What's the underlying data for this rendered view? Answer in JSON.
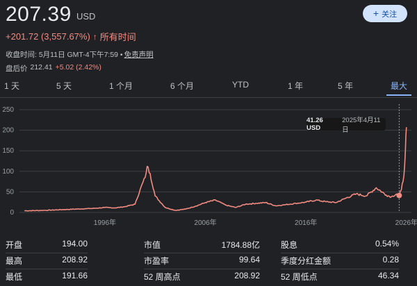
{
  "header": {
    "price": "207.39",
    "currency": "USD",
    "change": "+201.72 (3,557.67%)",
    "change_arrow": "↑",
    "change_period": "所有时间",
    "close_time": "收盘时间: 5月11日 GMT-4下午7:59 •",
    "disclaimer": "免责声明",
    "after_hours_label": "盘后价",
    "after_hours_price": "212.41",
    "after_hours_change": "+5.02 (2.42%)"
  },
  "follow_button": {
    "label": "关注",
    "icon": "plus-icon"
  },
  "tabs": [
    "1 天",
    "5 天",
    "1 个月",
    "6 个月",
    "YTD",
    "1 年",
    "5 年",
    "最大"
  ],
  "active_tab": "最大",
  "tooltip": {
    "value": "41.26 USD",
    "date": "2025年4月11日"
  },
  "colors": {
    "line": "#f28b82",
    "accent": "#8ab4f8",
    "background": "#202124",
    "follow_bg": "#d2e3fc"
  },
  "chart_data": {
    "type": "line",
    "yticks": [
      "0",
      "50",
      "100",
      "150",
      "200",
      "250"
    ],
    "ylim": [
      0,
      250
    ],
    "xticks": [
      "1996年",
      "2006年",
      "2016年",
      "2026年"
    ],
    "xlim": [
      1987.5,
      2026.5
    ],
    "grid": true,
    "x": [
      1988,
      1990,
      1992,
      1994,
      1995,
      1996,
      1997,
      1998,
      1999,
      1999.5,
      2000,
      2000.2,
      2000.5,
      2001,
      2002,
      2003,
      2004,
      2005,
      2006,
      2007,
      2008,
      2009,
      2010,
      2011,
      2012,
      2013,
      2014,
      2015,
      2016,
      2017,
      2018,
      2019,
      2020,
      2021,
      2022,
      2023,
      2024,
      2024.5,
      2025,
      2025.28,
      2025.5,
      2025.75,
      2025.9,
      2026
    ],
    "y": [
      4,
      5,
      7,
      9,
      10,
      12,
      11,
      14,
      20,
      55,
      85,
      112,
      95,
      40,
      12,
      5,
      8,
      15,
      24,
      30,
      18,
      12,
      20,
      22,
      24,
      16,
      19,
      22,
      25,
      30,
      26,
      24,
      35,
      45,
      40,
      60,
      42,
      38,
      45,
      41.26,
      55,
      90,
      150,
      207.39
    ]
  },
  "stats": [
    [
      {
        "label": "开盘",
        "value": "194.00"
      },
      {
        "label": "市值",
        "value": "1784.88亿"
      },
      {
        "label": "股息",
        "value": "0.54%"
      }
    ],
    [
      {
        "label": "最高",
        "value": "208.92"
      },
      {
        "label": "市盈率",
        "value": "99.64"
      },
      {
        "label": "季度分红金额",
        "value": "0.28"
      }
    ],
    [
      {
        "label": "最低",
        "value": "191.66"
      },
      {
        "label": "52 周高点",
        "value": "208.92"
      },
      {
        "label": "52 周低点",
        "value": "46.34"
      }
    ]
  ]
}
